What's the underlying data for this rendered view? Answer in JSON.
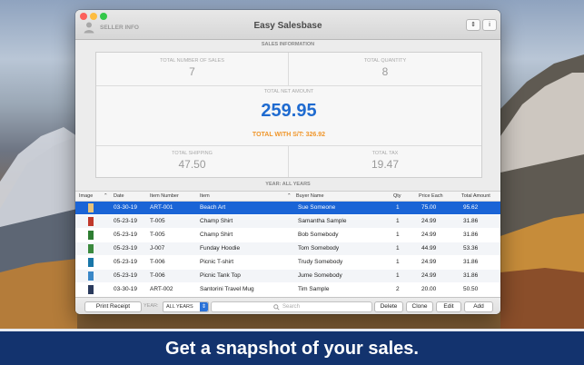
{
  "window": {
    "title": "Easy Salesbase",
    "seller_info_label": "SELLER INFO",
    "sort_button_glyph": "⇕",
    "info_button_glyph": "i"
  },
  "sales_information": {
    "header": "SALES INFORMATION",
    "total_sales_label": "TOTAL NUMBER OF SALES",
    "total_sales_value": "7",
    "total_quantity_label": "TOTAL QUANTITY",
    "total_quantity_value": "8",
    "net_amount_label": "TOTAL NET AMOUNT",
    "net_amount_value": "259.95",
    "total_with_st": "TOTAL WITH S/T: 326.92",
    "shipping_label": "TOTAL SHIPPING",
    "shipping_value": "47.50",
    "tax_label": "TOTAL TAX",
    "tax_value": "19.47"
  },
  "year_header": "YEAR: ALL YEARS",
  "table": {
    "columns": [
      "Image",
      "Date",
      "Item Number",
      "Item",
      "Buyer Name",
      "Qty",
      "Price Each",
      "Total Amount"
    ],
    "rows": [
      {
        "date": "03-30-19",
        "item_number": "ART-001",
        "item": "Beach Art",
        "buyer": "Sue Someone",
        "qty": "1",
        "price": "75.00",
        "total": "95.62",
        "selected": true
      },
      {
        "date": "05-23-19",
        "item_number": "T-005",
        "item": "Champ Shirt",
        "buyer": "Samantha Sample",
        "qty": "1",
        "price": "24.99",
        "total": "31.86"
      },
      {
        "date": "05-23-19",
        "item_number": "T-005",
        "item": "Champ Shirt",
        "buyer": "Bob Somebody",
        "qty": "1",
        "price": "24.99",
        "total": "31.86"
      },
      {
        "date": "05-23-19",
        "item_number": "J-007",
        "item": "Funday Hoodie",
        "buyer": "Tom Somebody",
        "qty": "1",
        "price": "44.99",
        "total": "53.36"
      },
      {
        "date": "05-23-19",
        "item_number": "T-006",
        "item": "Picnic T-shirt",
        "buyer": "Trudy Somebody",
        "qty": "1",
        "price": "24.99",
        "total": "31.86"
      },
      {
        "date": "05-23-19",
        "item_number": "T-006",
        "item": "Picnic Tank Top",
        "buyer": "Jume Somebody",
        "qty": "1",
        "price": "24.99",
        "total": "31.86"
      },
      {
        "date": "03-30-19",
        "item_number": "ART-002",
        "item": "Santorini Travel Mug",
        "buyer": "Tim Sample",
        "qty": "2",
        "price": "20.00",
        "total": "50.50"
      }
    ]
  },
  "bottom_bar": {
    "print_receipt": "Print Receipt",
    "year_label": "YEAR:",
    "year_select": "ALL YEARS",
    "search_placeholder": "Search",
    "delete": "Delete",
    "clone": "Clone",
    "edit": "Edit",
    "add": "Add"
  },
  "banner_text": "Get a snapshot of your sales.",
  "colors": {
    "selection": "#1a64d6",
    "net_amount": "#1f6bd0",
    "total_with_st": "#f0962a",
    "banner": "#13336e"
  },
  "icons": [
    "user-icon",
    "sort-icon",
    "info-icon",
    "search-icon",
    "sort-arrow-icon",
    "dropdown-icon"
  ]
}
